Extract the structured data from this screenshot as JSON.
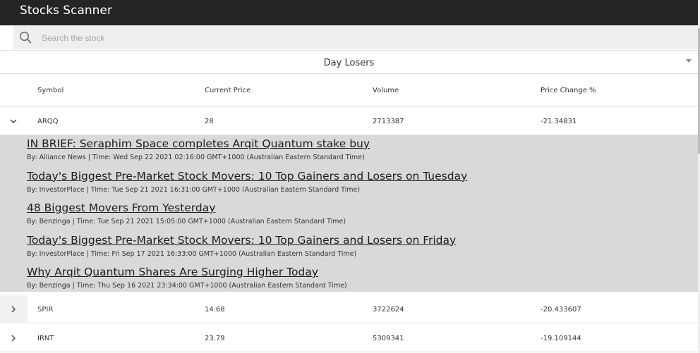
{
  "app": {
    "title": "Stocks Scanner"
  },
  "search": {
    "placeholder": "Search the stock",
    "value": "",
    "icon": "search-icon"
  },
  "filter": {
    "selected": "Day Losers",
    "icon": "dropdown-caret-icon"
  },
  "table": {
    "headers": [
      "Symbol",
      "Current Price",
      "Volume",
      "Price Change %"
    ],
    "rows": [
      {
        "symbol": "ARQQ",
        "price": "28",
        "volume": "2713387",
        "change": "-21.34831",
        "expanded": true,
        "icon": "chevron-down-icon"
      },
      {
        "symbol": "SPIR",
        "price": "14.68",
        "volume": "3722624",
        "change": "-20.433607",
        "expanded": false,
        "icon": "chevron-right-icon"
      },
      {
        "symbol": "IRNT",
        "price": "23.79",
        "volume": "5309341",
        "change": "-19.109144",
        "expanded": false,
        "icon": "chevron-right-icon"
      }
    ]
  },
  "news": [
    {
      "title": "IN BRIEF: Seraphim Space completes Arqit Quantum stake buy",
      "meta": "By: Alliance News | Time: Wed Sep 22 2021 02:16:00 GMT+1000 (Australian Eastern Standard Time)"
    },
    {
      "title": "Today's Biggest Pre-Market Stock Movers: 10 Top Gainers and Losers on Tuesday",
      "meta": "By: InvestorPlace | Time: Tue Sep 21 2021 16:31:00 GMT+1000 (Australian Eastern Standard Time)"
    },
    {
      "title": "48 Biggest Movers From Yesterday",
      "meta": "By: Benzinga | Time: Tue Sep 21 2021 15:05:00 GMT+1000 (Australian Eastern Standard Time)"
    },
    {
      "title": "Today's Biggest Pre-Market Stock Movers: 10 Top Gainers and Losers on Friday",
      "meta": "By: InvestorPlace | Time: Fri Sep 17 2021 16:33:00 GMT+1000 (Australian Eastern Standard Time)"
    },
    {
      "title": "Why Arqit Quantum Shares Are Surging Higher Today",
      "meta": "By: Benzinga | Time: Thu Sep 16 2021 23:34:00 GMT+1000 (Australian Eastern Standard Time)"
    }
  ],
  "colors": {
    "appbar": "#232426",
    "news_background": "#d9d9d9",
    "search_background": "#eeeeee"
  }
}
